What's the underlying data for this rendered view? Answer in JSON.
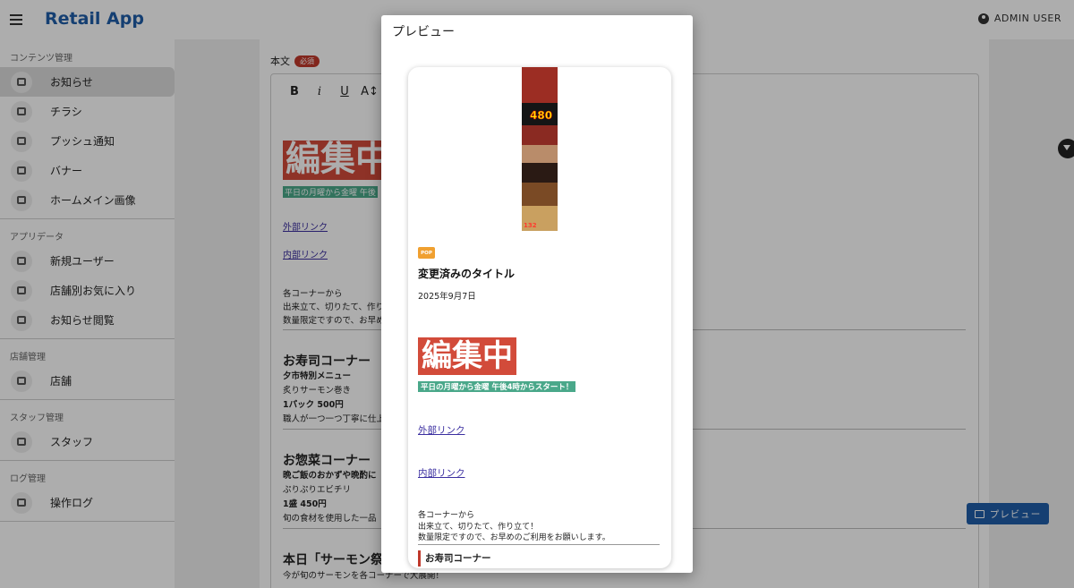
{
  "app": {
    "title": "Retail App",
    "user": "ADMIN USER"
  },
  "sidebar": {
    "sections": [
      {
        "title": "コンテンツ管理",
        "items": [
          {
            "label": "お知らせ",
            "icon": "message-icon",
            "active": true
          },
          {
            "label": "チラシ",
            "icon": "map-icon"
          },
          {
            "label": "プッシュ通知",
            "icon": "chat-icon"
          },
          {
            "label": "バナー",
            "icon": "image-stack-icon"
          },
          {
            "label": "ホームメイン画像",
            "icon": "phone-image-icon"
          }
        ]
      },
      {
        "title": "アプリデータ",
        "items": [
          {
            "label": "新規ユーザー",
            "icon": "bar-chart-icon"
          },
          {
            "label": "店舗別お気に入り",
            "icon": "bar-chart-icon"
          },
          {
            "label": "お知らせ閲覧",
            "icon": "bar-chart-icon"
          }
        ]
      },
      {
        "title": "店舗管理",
        "items": [
          {
            "label": "店舗",
            "icon": "store-icon"
          }
        ]
      },
      {
        "title": "スタッフ管理",
        "items": [
          {
            "label": "スタッフ",
            "icon": "group-icon"
          }
        ]
      },
      {
        "title": "ログ管理",
        "items": [
          {
            "label": "操作ログ",
            "icon": "history-icon"
          }
        ]
      }
    ]
  },
  "editor": {
    "label": "本文",
    "required_badge": "必須",
    "toolbar": {
      "bold": "B",
      "italic": "i",
      "underline": "U",
      "text_size": "A↕"
    },
    "banner": "編集中",
    "green_text": "平日の月曜から金曜 午後",
    "external_link": "外部リンク",
    "internal_link": "内部リンク",
    "para_lines": [
      "各コーナーから",
      "出来立て、切りたて、作り",
      "数量限定ですので、お早め"
    ],
    "sushi_heading": "お寿司コーナー",
    "sushi_lines": [
      "夕市特別メニュー",
      "炙りサーモン巻き",
      "1パック 500円",
      "職人が一つ一つ丁寧に仕上"
    ],
    "deli_heading": "お惣菜コーナー",
    "deli_lines": [
      "晩ご飯のおかずや晩酌に",
      "ぷりぷりエビチリ",
      "1盛 450円",
      "旬の食材を使用した一品"
    ],
    "salmon_heading": "本日「サーモン祭",
    "salmon_line": "今が旬のサーモンを各コーナーで大展開！"
  },
  "preview_button": "プレビュー",
  "dialog": {
    "title": "プレビュー",
    "flyer": {
      "price": "480",
      "price2": "132"
    },
    "badge": "POP",
    "item_title": "変更済みのタイトル",
    "date": "2025年9月7日",
    "banner": "編集中",
    "green_text": "平日の月曜から金曜 午後4時からスタート！",
    "external_link": "外部リンク",
    "internal_link": "内部リンク",
    "para_lines": [
      "各コーナーから",
      "出来立て、切りたて、作り立て！",
      "数量限定ですので、お早めのご利用をお願いします。"
    ],
    "heading": "お寿司コーナー"
  },
  "colors": {
    "brand": "#1f5ea8",
    "badge": "#c0392b",
    "banner_red": "#d24b3a",
    "highlight_green": "#4aa88a",
    "pop_orange": "#f0a030"
  }
}
